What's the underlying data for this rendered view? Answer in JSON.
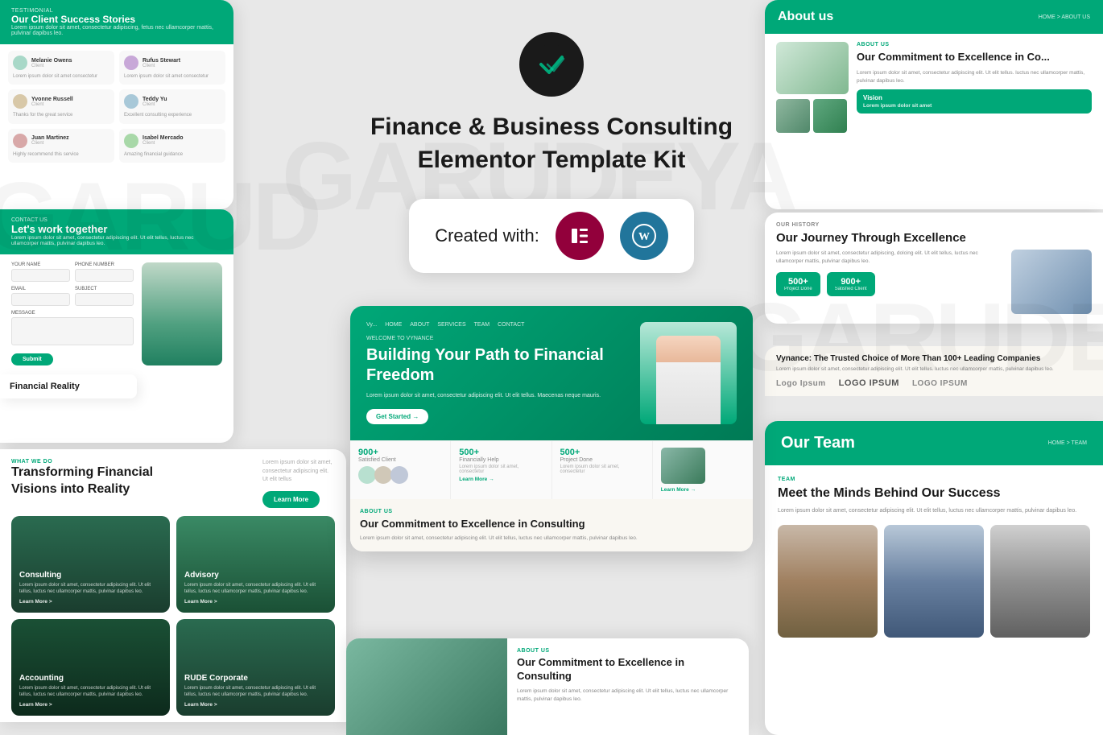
{
  "hero": {
    "title": "Finance & Business Consulting Elementor Template Kit",
    "logo_alt": "Vynance Logo",
    "created_with": "Created with:",
    "elementor_label": "E",
    "wp_label": "W"
  },
  "watermarks": {
    "left": "GARUD",
    "center": "GARUDEYA",
    "right": "GARUDE"
  },
  "testimonials": {
    "section_label": "TESTIMONIAL",
    "title": "Our Client Success Stories",
    "subtitle": "Lorem ipsum dolor sit amet, consectetur adipiscing, fetus nec ullamcorper mattis, pulvinar dapibus leo.",
    "cards": [
      {
        "name": "Melanie Owens",
        "role": "Client",
        "color": "#a8d8c8"
      },
      {
        "name": "Rufus Stewart",
        "role": "Client",
        "color": "#c8a8d8"
      },
      {
        "name": "Yvonne Russell",
        "role": "Client",
        "color": "#d8c8a8"
      },
      {
        "name": "Teddy Yu",
        "role": "Client",
        "color": "#a8c8d8"
      },
      {
        "name": "Juan Martinez",
        "role": "Client",
        "color": "#d8a8a8"
      },
      {
        "name": "Isabel Mercado",
        "role": "Client",
        "color": "#a8d8a8"
      }
    ]
  },
  "contact": {
    "label": "CONTACT US",
    "title": "Let's work together",
    "subtitle": "Lorem ipsum dolor sit amet, consectetur adipiscing elit. Ut elit tellus, luctus nec ullamcorper mattis, pulvinar dapibus leo.",
    "form": {
      "name_label": "YOUR NAME",
      "phone_label": "PHONE NUMBER",
      "email_label": "EMAIL",
      "subject_label": "SUBJECT",
      "message_label": "MESSAGE",
      "submit": "Submit"
    }
  },
  "financial_reality": {
    "title": "Financial Reality"
  },
  "services": {
    "section_label": "WHAT WE DO",
    "title": "Transforming Financial Visions into Reality",
    "description": "Lorem ipsum dolor sit amet, consectetur adipiscing elit. Ut elit tellus",
    "learn_more": "Learn More",
    "items": [
      {
        "id": "consulting",
        "title": "Consulting",
        "description": "Lorem ipsum dolor sit amet, consectetur adipiscing elit. Ut elit tellus, luctus nec ullamcorper mattis, pulvinar dapibus leo.",
        "link": "Learn More >"
      },
      {
        "id": "advisory",
        "title": "Advisory",
        "description": "Lorem ipsum dolor sit amet, consectetur adipiscing elit. Ut elit tellus, luctus nec ullamcorper mattis, pulvinar dapibus leo.",
        "link": "Learn More >"
      },
      {
        "id": "accounting",
        "title": "Accounting",
        "description": "Lorem ipsum dolor sit amet, consectetur adipiscing elit. Ut elit tellus, luctus nec ullamcorper mattis, pulvinar dapibus leo.",
        "link": "Learn More >"
      },
      {
        "id": "corporate",
        "title": "RUDE Corporate",
        "description": "Lorem ipsum dolor sit amet, consectetur adipiscing elit. Ut elit tellus, luctus nec ullamcorper mattis, pulvinar dapibus leo.",
        "link": "Learn More >"
      }
    ]
  },
  "preview": {
    "nav": [
      "Vy...",
      "HOME",
      "ABOUT",
      "SERVICES",
      "TEAM",
      "CONTACT"
    ],
    "hero_label": "WELCOME TO VYNANCE",
    "hero_title": "Building Your Path to Financial Freedom",
    "hero_subtitle": "Lorem ipsum dolor sit amet, consectetur adipiscing elit. Ut elit tellus. Maecenas neque mauris.",
    "hero_cta": "Get Started →",
    "stats": [
      {
        "num": "900+",
        "label": "Satisfied Client",
        "desc": ""
      },
      {
        "num": "500+",
        "label": "Financially Help",
        "desc": "Lorem ipsum dolor sit amet, consectetur"
      },
      {
        "num": "500+",
        "label": "Project Done",
        "desc": "Lorem ipsum dolor sit amet, consectetur"
      },
      {
        "num": "",
        "label": "",
        "link": "Learn More →"
      }
    ],
    "about_label": "ABOUT US",
    "about_title": "Our Commitment to Excellence in Consulting",
    "about_desc": "Lorem ipsum dolor sit amet, consectetur adipiscing elit. Ut elit tellus, luctus nec ullamcorper mattis, pulvinar dapibus leo."
  },
  "about": {
    "header_title": "About us",
    "header_nav": "HOME > ABOUT US",
    "label": "ABOUT US",
    "title": "Our Commitment to Excellence in Co...",
    "description": "Lorem ipsum dolor sit amet, consectetur adipiscing elit. Ut elit tellus. luctus nec ullamcorper mattis, pulvinar dapibus leo.",
    "vision_title": "Vision",
    "vision_desc": "Lorem ipsum dolor sit amet"
  },
  "history": {
    "label": "OUR HISTORY",
    "title": "Our Journey Through Excellence",
    "description": "Lorem ipsum dolor sit amet, consectetur adipiscing, dolcing elit. Ut elit tellus, luctus nec ullamcorper mattis, pulvinar dapibus leo.",
    "stats": [
      {
        "num": "500+",
        "label": "Project Done"
      },
      {
        "num": "900+",
        "label": "Satisfied Client"
      }
    ]
  },
  "trusted": {
    "title": "Vynance: The Trusted Choice of More Than 100+ Leading Companies",
    "description": "Lorem ipsum dolor sit amet, consectetur adipiscing elit. Ut elit tellus. luctus nec ullamcorper mattis, pulvinar dapibus leo.",
    "logos": [
      "Logo Ipsum",
      "LOGO IPSUM",
      "LOGO IPSUM"
    ]
  },
  "team": {
    "header_title": "Our Team",
    "header_nav": "HOME > TEAM",
    "label": "TEAM",
    "title": "Meet the Minds Behind Our Success",
    "description": "Lorem ipsum dolor sit amet, consectetur adipiscing elit. Ut elit tellus, luctus nec ullamcorper mattis, pulvinar dapibus leo."
  },
  "accent_color": "#00a878"
}
